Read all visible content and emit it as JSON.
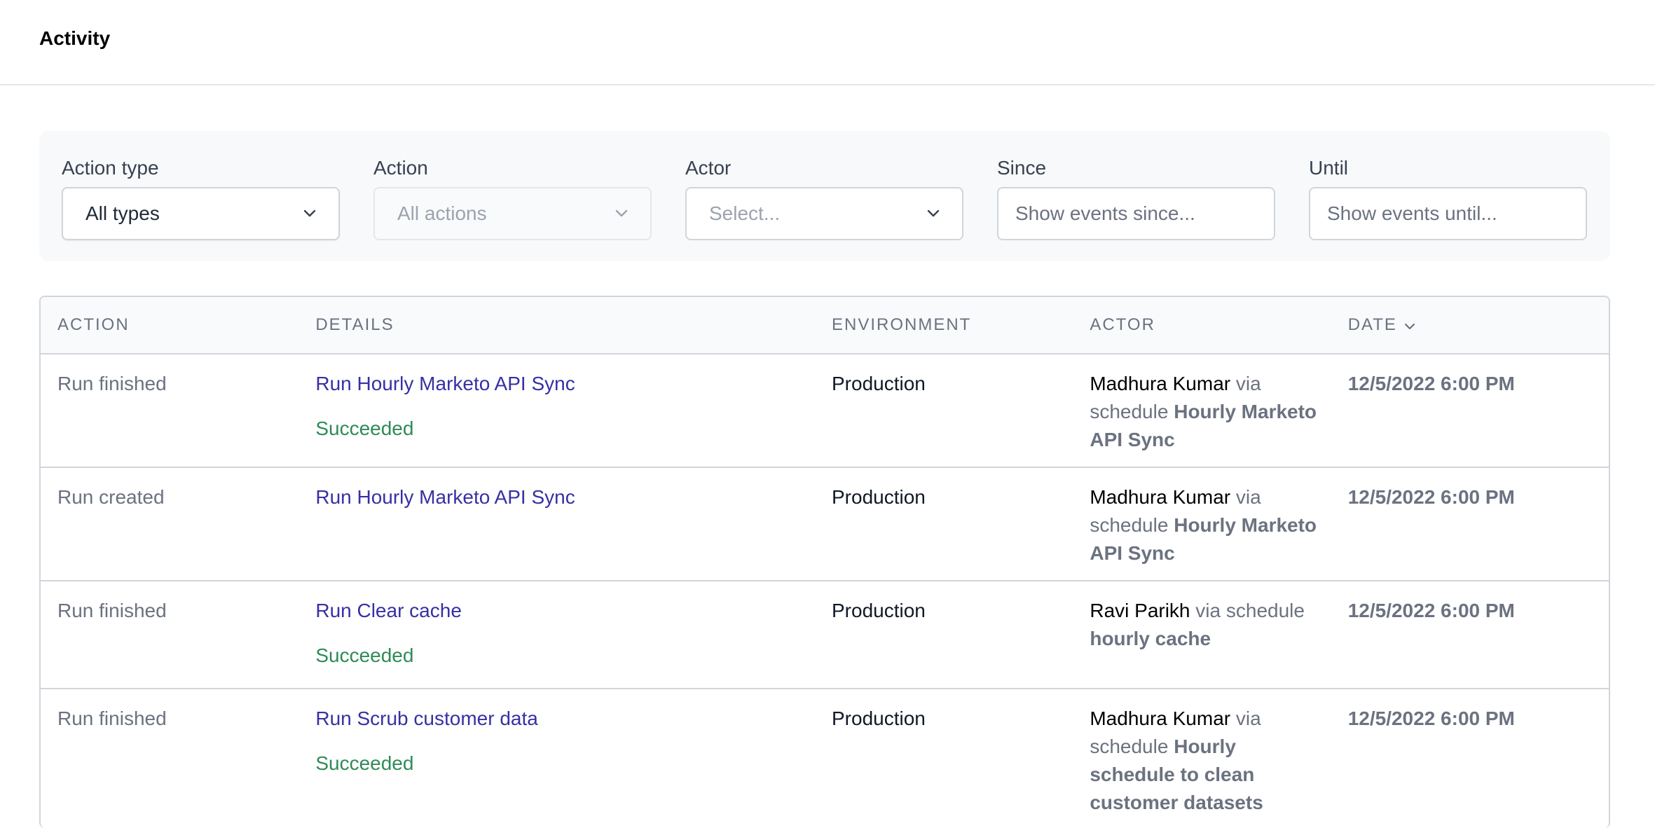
{
  "header": {
    "title": "Activity"
  },
  "filters": [
    {
      "label": "Action type",
      "value": "All types",
      "kind": "select",
      "state": "selected"
    },
    {
      "label": "Action",
      "value": "All actions",
      "kind": "select",
      "state": "disabled"
    },
    {
      "label": "Actor",
      "value": "Select...",
      "kind": "select",
      "state": "placeholder"
    },
    {
      "label": "Since",
      "value": "Show events since...",
      "kind": "input"
    },
    {
      "label": "Until",
      "value": "Show events until...",
      "kind": "input"
    }
  ],
  "table": {
    "columns": [
      "ACTION",
      "DETAILS",
      "ENVIRONMENT",
      "ACTOR",
      "DATE"
    ],
    "rows": [
      {
        "action": "Run finished",
        "details": "Run Hourly Marketo API Sync",
        "status": "Succeeded",
        "environment": "Production",
        "actor_name": "Madhura Kumar",
        "actor_via_line1": " via",
        "actor_via_line2": "schedule ",
        "schedule": "Hourly Marketo API Sync",
        "date": "12/5/2022 6:00 PM"
      },
      {
        "action": "Run created",
        "details": "Run Hourly Marketo API Sync",
        "status": "",
        "environment": "Production",
        "actor_name": "Madhura Kumar",
        "actor_via_line1": " via",
        "actor_via_line2": "schedule ",
        "schedule": "Hourly Marketo API Sync",
        "date": "12/5/2022 6:00 PM"
      },
      {
        "action": "Run finished",
        "details": "Run Clear cache",
        "status": "Succeeded",
        "environment": "Production",
        "actor_name": "Ravi Parikh",
        "actor_via_line1": " via schedule",
        "actor_via_line2": "",
        "schedule": "hourly cache",
        "date": "12/5/2022 6:00 PM"
      },
      {
        "action": "Run finished",
        "details": "Run Scrub customer data",
        "status": "Succeeded",
        "environment": "Production",
        "actor_name": "Madhura Kumar",
        "actor_via_line1": " via",
        "actor_via_line2": "schedule ",
        "schedule": "Hourly schedule to clean customer datasets",
        "date": "12/5/2022 6:00 PM"
      }
    ]
  },
  "icons": {
    "dropdown": "chevron-down-icon",
    "sort": "chevron-down-icon"
  },
  "colors": {
    "link": "#3730a3",
    "success": "#2f8a57",
    "muted": "#6b7280"
  }
}
